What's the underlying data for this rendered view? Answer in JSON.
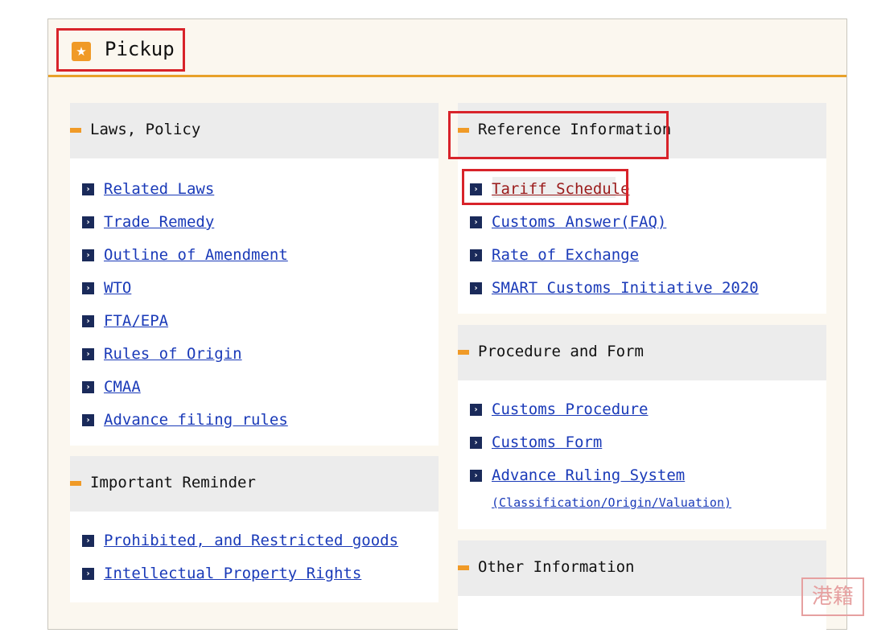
{
  "panel": {
    "title": "Pickup",
    "icon": "star-icon",
    "star_glyph": "★"
  },
  "colors": {
    "accent_orange": "#f09a27",
    "highlight_red": "#d8232a",
    "link_blue": "#1a3ab8",
    "visited_link": "#9a1a1a"
  },
  "arrow_glyph": "›",
  "sections": {
    "laws_policy": {
      "title": "Laws, Policy",
      "links": [
        "Related Laws",
        "Trade Remedy",
        "Outline of Amendment",
        "WTO",
        "FTA/EPA",
        "Rules of Origin",
        "CMAA",
        "Advance filing rules"
      ]
    },
    "important_reminder": {
      "title": "Important Reminder",
      "links": [
        "Prohibited, and Restricted goods",
        "Intellectual Property Rights"
      ]
    },
    "reference_information": {
      "title": "Reference Information",
      "links": [
        "Tariff Schedule",
        "Customs Answer(FAQ)",
        "Rate of Exchange",
        "SMART Customs Initiative 2020"
      ]
    },
    "procedure_form": {
      "title": "Procedure and Form",
      "links": [
        "Customs Procedure",
        "Customs Form",
        "Advance Ruling System"
      ],
      "sublink": "(Classification/Origin/Valuation)"
    },
    "other_information": {
      "title": "Other Information"
    }
  },
  "watermark": {
    "icon": "watermark-seal-icon",
    "text": "港籍"
  }
}
